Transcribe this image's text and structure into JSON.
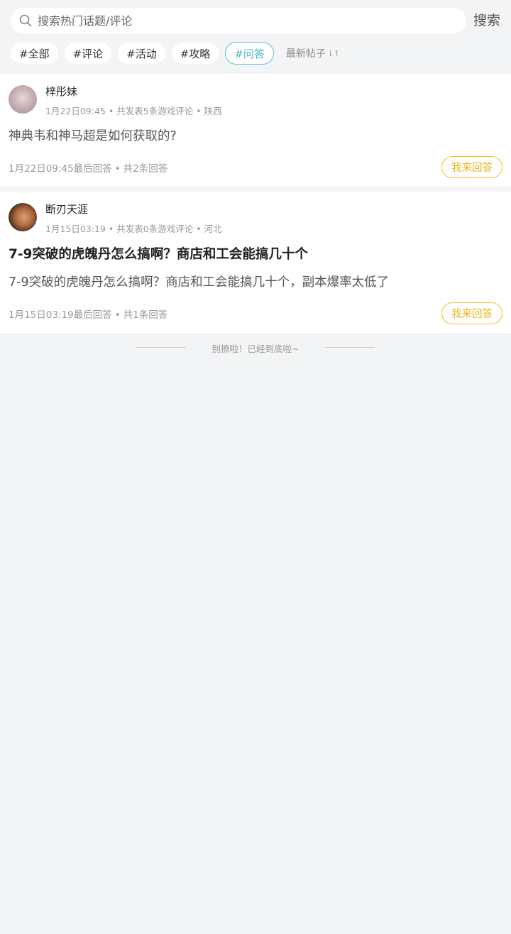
{
  "search": {
    "placeholder": "搜索热门话题/评论",
    "button_label": "搜索",
    "icon": "search-icon"
  },
  "tags": [
    {
      "label": "#全部",
      "active": false
    },
    {
      "label": "#评论",
      "active": false
    },
    {
      "label": "#活动",
      "active": false
    },
    {
      "label": "#攻略",
      "active": false
    },
    {
      "label": "#问答",
      "active": true
    }
  ],
  "sort": {
    "label": "最新帖子",
    "icon": "sort-icon"
  },
  "posts": [
    {
      "username": "梓彤妹",
      "time": "1月22日09:45",
      "stats": "共发表5条游戏评论",
      "region": "陕西",
      "title": "",
      "body": "神典韦和神马超是如何获取的?",
      "last_reply": "1月22日09:45最后回答",
      "reply_count": "共2条回答",
      "answer_label": "我来回答"
    },
    {
      "username": "断刃天涯",
      "time": "1月15日03:19",
      "stats": "共发表0条游戏评论",
      "region": "河北",
      "title": "7-9突破的虎魄丹怎么搞啊？商店和工会能搞几十个",
      "body": "7-9突破的虎魄丹怎么搞啊？商店和工会能搞几十个，副本爆率太低了",
      "last_reply": "1月15日03:19最后回答",
      "reply_count": "共1条回答",
      "answer_label": "我来回答"
    }
  ],
  "end_text": "别撩啦！已经到底啦~",
  "colors": {
    "accent_active_tag": "#49b5c3",
    "answer_button": "#eeb21c",
    "background": "#f3f4f6"
  }
}
